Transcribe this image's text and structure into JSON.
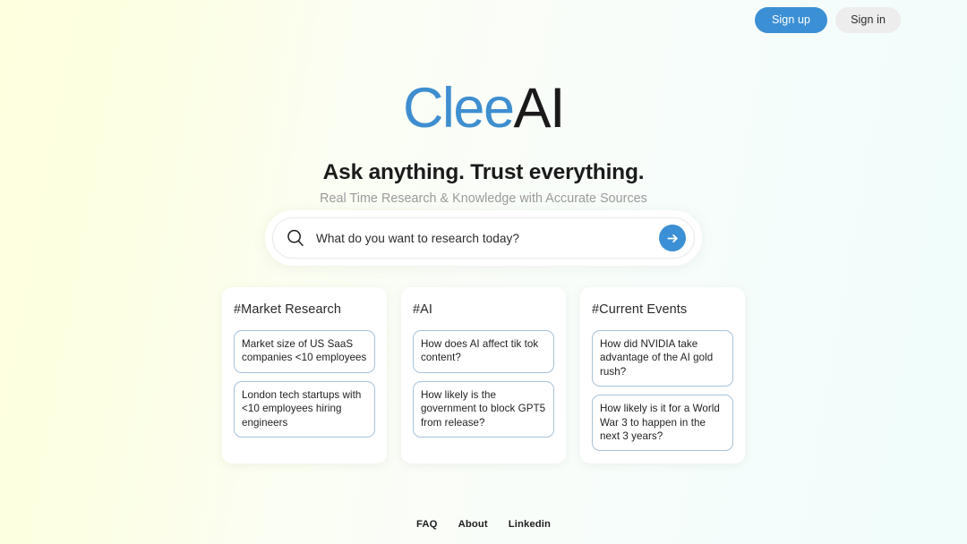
{
  "brand": {
    "name_primary": "Clee",
    "name_secondary": "AI",
    "primary_color": "#3e8ed0",
    "secondary_color": "#1a1a1a",
    "accent_color": "#3b8fd4"
  },
  "topbar": {
    "sign_up_label": "Sign up",
    "sign_in_label": "Sign in"
  },
  "hero": {
    "headline": "Ask anything. Trust everything.",
    "subheadline": "Real Time Research & Knowledge with Accurate Sources"
  },
  "search": {
    "placeholder": "What do you want to research today?",
    "value": "",
    "search_icon": "search-icon",
    "submit_icon": "arrow-right-icon"
  },
  "cards": [
    {
      "title": "#Market Research",
      "suggestions": [
        "Market size of US SaaS companies <10 employees",
        "London tech startups with <10 employees hiring engineers"
      ]
    },
    {
      "title": "#AI",
      "suggestions": [
        "How does AI affect tik tok content?",
        "How likely is the government to block GPT5 from release?"
      ]
    },
    {
      "title": "#Current Events",
      "suggestions": [
        "How did NVIDIA take advantage of the AI gold rush?",
        "How likely is it for a World War 3 to happen in the next 3 years?"
      ]
    }
  ],
  "footer": {
    "links": [
      {
        "label": "FAQ"
      },
      {
        "label": "About"
      },
      {
        "label": "Linkedin"
      }
    ]
  }
}
